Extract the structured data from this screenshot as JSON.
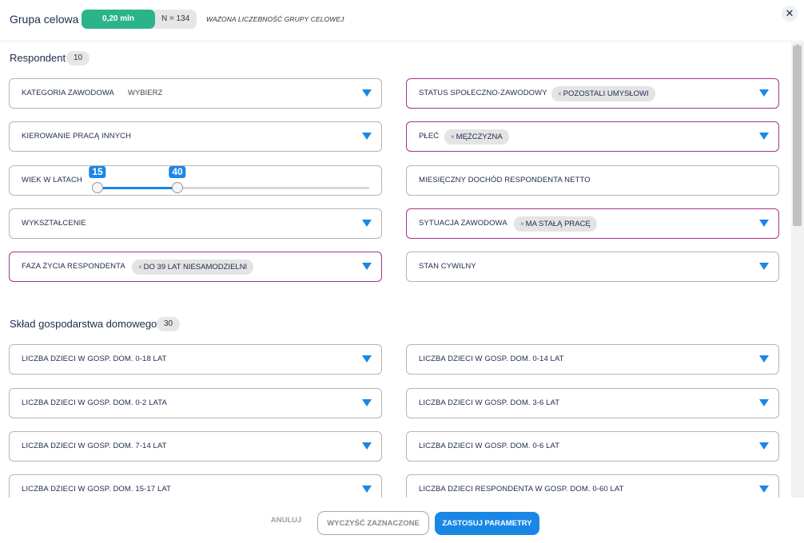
{
  "header": {
    "title": "Grupa celowa",
    "population": "0,20 mln osób",
    "sample": "N = 134",
    "weighted_label": "WAŻONA LICZEBNOŚĆ GRUPY CELOWEJ",
    "close_icon": "close-icon"
  },
  "respondent": {
    "title": "Respondent",
    "count": "10",
    "fields": {
      "kategoria": {
        "label": "KATEGORIA ZAWODOWA",
        "placeholder": "WYBIERZ"
      },
      "status": {
        "label": "STATUS SPOŁECZNO-ZAWODOWY",
        "chip": "POZOSTALI UMYSŁOWI"
      },
      "kierowanie": {
        "label": "KIEROWANIE PRACĄ INNYCH"
      },
      "plec": {
        "label": "PŁEĆ",
        "chip": "MĘŻCZYZNA"
      },
      "wiek": {
        "label": "WIEK W LATACH",
        "min_label": "15",
        "max_label": "40",
        "range_min": 15,
        "range_max": 40,
        "scale_min": 15,
        "scale_max": 100
      },
      "dochod": {
        "label": "MIESIĘCZNY DOCHÓD RESPONDENTA NETTO"
      },
      "wyksztalcenie": {
        "label": "WYKSZTAŁCENIE"
      },
      "sytuacja": {
        "label": "SYTUACJA ZAWODOWA",
        "chip": "MA STAŁĄ PRACĘ"
      },
      "faza": {
        "label": "FAZA ŻYCIA RESPONDENTA",
        "chip": "DO 39 LAT NIESAMODZIELNI"
      },
      "stan": {
        "label": "STAN CYWILNY"
      }
    }
  },
  "household": {
    "title": "Skład gospodarstwa domowego",
    "count": "30",
    "fields": [
      {
        "label": "LICZBA DZIECI W GOSP. DOM. 0-18 LAT"
      },
      {
        "label": "LICZBA DZIECI W GOSP. DOM. 0-14 LAT"
      },
      {
        "label": "LICZBA DZIECI W GOSP. DOM. 0-2 LATA"
      },
      {
        "label": "LICZBA DZIECI W GOSP. DOM. 3-6 LAT"
      },
      {
        "label": "LICZBA DZIECI W GOSP. DOM. 7-14 LAT"
      },
      {
        "label": "LICZBA DZIECI W GOSP. DOM. 0-6 LAT"
      },
      {
        "label": "LICZBA DZIECI W GOSP. DOM. 15-17 LAT"
      },
      {
        "label": "LICZBA DZIECI RESPONDENTA W GOSP. DOM. 0-60 LAT"
      }
    ]
  },
  "footer": {
    "cancel": "ANULUJ",
    "clear": "WYCZYŚĆ ZAZNACZONE",
    "apply": "ZASTOSUJ PARAMETRY"
  },
  "colors": {
    "accent_blue": "#1a87e6",
    "green": "#2bb389",
    "active_border": "#a5338e"
  }
}
